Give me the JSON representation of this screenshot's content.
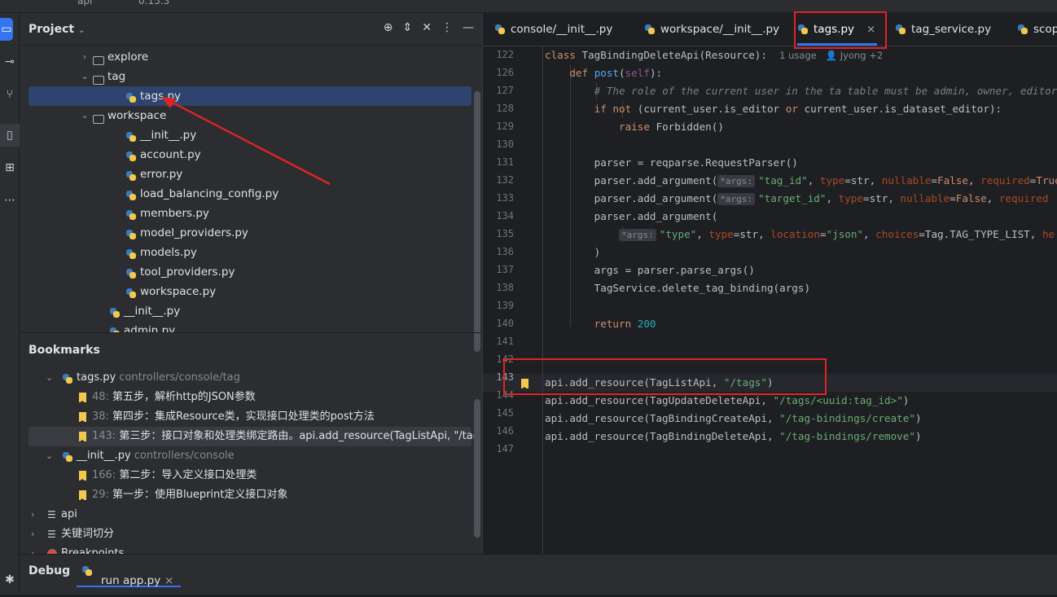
{
  "titlebar": {
    "left_text": "api",
    "right_text": "0.15.3"
  },
  "toolstrip": {
    "icons": [
      "project-icon",
      "commit-icon",
      "pull-requests-icon",
      "bookmarks-icon",
      "structure-icon",
      "more-icon"
    ]
  },
  "project_panel": {
    "title": "Project",
    "tree": [
      {
        "label": "explore",
        "type": "folder",
        "collapsed": true
      },
      {
        "label": "tag",
        "type": "folder",
        "collapsed": false
      },
      {
        "label": "tags.py",
        "type": "py",
        "selected": true
      },
      {
        "label": "workspace",
        "type": "package",
        "collapsed": false
      },
      {
        "label": "__init__.py",
        "type": "py"
      },
      {
        "label": "account.py",
        "type": "py"
      },
      {
        "label": "error.py",
        "type": "py"
      },
      {
        "label": "load_balancing_config.py",
        "type": "py"
      },
      {
        "label": "members.py",
        "type": "py"
      },
      {
        "label": "model_providers.py",
        "type": "py"
      },
      {
        "label": "models.py",
        "type": "py"
      },
      {
        "label": "tool_providers.py",
        "type": "py"
      },
      {
        "label": "workspace.py",
        "type": "py"
      },
      {
        "label": "__init__.py",
        "type": "py"
      },
      {
        "label": "admin.py",
        "type": "py"
      }
    ]
  },
  "bookmarks_panel": {
    "title": "Bookmarks",
    "items": [
      {
        "label": "tags.py",
        "path": "controllers/console/tag",
        "kind": "file"
      },
      {
        "line": "48:",
        "text": "第五步，解析http的JSON参数",
        "kind": "bookmark"
      },
      {
        "line": "38:",
        "text": "第四步：集成Resource类，实现接口处理类的post方法",
        "kind": "bookmark"
      },
      {
        "line": "143:",
        "text": "第三步：接口对象和处理类绑定路由。api.add_resource(TagListApi, \"/tags\")",
        "kind": "bookmark",
        "selected": true
      },
      {
        "label": "__init__.py",
        "path": "controllers/console",
        "kind": "file"
      },
      {
        "line": "166:",
        "text": "第二步：导入定义接口处理类",
        "kind": "bookmark"
      },
      {
        "line": "29:",
        "text": "第一步：使用Blueprint定义接口对象",
        "kind": "bookmark"
      },
      {
        "label": "api",
        "kind": "list"
      },
      {
        "label": "关键词切分",
        "kind": "list"
      },
      {
        "label": "Breakpoints",
        "kind": "breakpoints"
      }
    ]
  },
  "editor": {
    "tabs": [
      {
        "label": "console/__init__.py"
      },
      {
        "label": "workspace/__init__.py"
      },
      {
        "label": "tags.py",
        "active": true,
        "close": "×"
      },
      {
        "label": "tag_service.py"
      },
      {
        "label": "scop"
      }
    ],
    "line_numbers": [
      "122",
      "126",
      "127",
      "128",
      "129",
      "130",
      "131",
      "132",
      "133",
      "134",
      "135",
      "136",
      "137",
      "138",
      "139",
      "140",
      "141",
      "142",
      "143",
      "144",
      "145",
      "146",
      "147"
    ],
    "sticky_usage": "1 usage",
    "sticky_author": "Jyong +2",
    "hint_args": "*args:"
  },
  "debug": {
    "title": "Debug",
    "tab": "run app.py",
    "close": "×"
  }
}
